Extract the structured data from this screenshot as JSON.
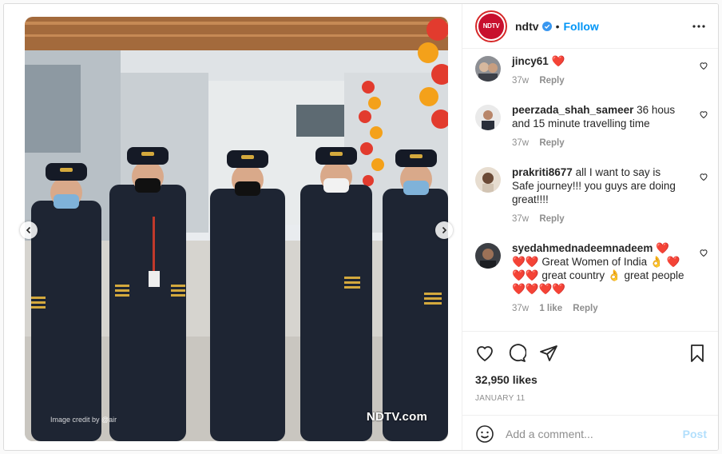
{
  "header": {
    "username": "ndtv",
    "avatar_text": "NDTV",
    "separator": "•",
    "follow_label": "Follow",
    "more_icon": "more-horizontal-icon",
    "verified_icon": "verified-badge-icon"
  },
  "media": {
    "watermark": "NDTV.com",
    "credit": "Image credit by @air",
    "prev_icon": "chevron-left-icon",
    "next_icon": "chevron-right-icon"
  },
  "comments": [
    {
      "username": "jincy61",
      "text": "",
      "emoji": "❤️",
      "time": "37w",
      "likes": "",
      "reply": "Reply"
    },
    {
      "username": "peerzada_shah_sameer",
      "text": "36 hous and 15 minute travelling time",
      "emoji": "",
      "time": "37w",
      "likes": "",
      "reply": "Reply"
    },
    {
      "username": "prakriti8677",
      "text": "all I want to say is Safe journey!!! you guys are doing great!!!!",
      "emoji": "",
      "time": "37w",
      "likes": "",
      "reply": "Reply"
    },
    {
      "username": "syedahmednadeemnadeem",
      "text": "❤️ ❤️❤️ Great Women of India 👌 ❤️❤️❤️ great country 👌 great people❤️❤️❤️❤️",
      "emoji": "",
      "time": "37w",
      "likes": "1 like",
      "reply": "Reply"
    }
  ],
  "actions": {
    "like_icon": "heart-icon",
    "comment_icon": "comment-bubble-icon",
    "share_icon": "paper-plane-icon",
    "save_icon": "bookmark-icon"
  },
  "likes_text": "32,950 likes",
  "date": "JANUARY 11",
  "composer": {
    "emoji_icon": "smiley-icon",
    "placeholder": "Add a comment...",
    "post_label": "Post"
  },
  "colors": {
    "accent": "#0095f6",
    "brand": "#c8102e",
    "heart": "#ed1c24",
    "muted": "#8e8e8e",
    "post_disabled": "#b2dffc"
  }
}
